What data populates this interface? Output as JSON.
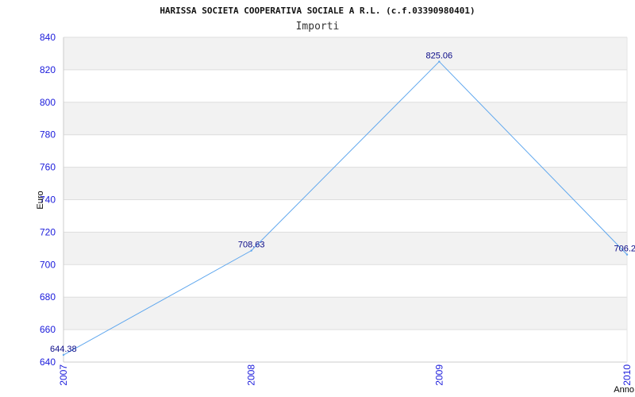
{
  "chart_data": {
    "type": "line",
    "title": "HARISSA SOCIETA COOPERATIVA SOCIALE A R.L. (c.f.03390980401)",
    "subtitle": "Importi",
    "xlabel": "Anno",
    "ylabel": "Euro",
    "categories": [
      "2007",
      "2008",
      "2009",
      "2010"
    ],
    "series": [
      {
        "values": [
          644.38,
          708.63,
          825.06,
          706.2
        ],
        "labels": [
          "644.38",
          "708.63",
          "825.06",
          "706.2"
        ]
      }
    ],
    "ylim": [
      640,
      840
    ],
    "yticks": [
      "640",
      "660",
      "680",
      "700",
      "720",
      "740",
      "760",
      "780",
      "800",
      "820",
      "840"
    ],
    "grid": true,
    "colors": {
      "line": "#5fa7ee",
      "tick_text": "#1a1adb",
      "band": "#f2f2f2",
      "grid": "#dddddd"
    }
  }
}
